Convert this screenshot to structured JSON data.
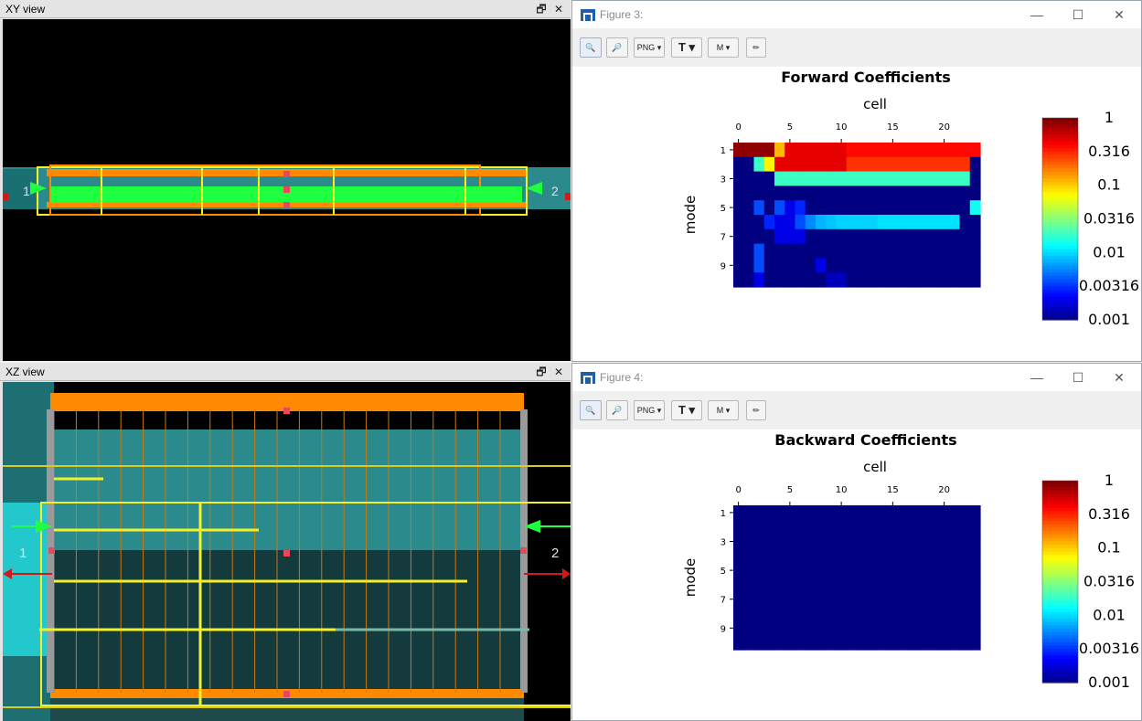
{
  "xy_view": {
    "title": "XY view",
    "restore_icon": "🗗",
    "close_icon": "✕",
    "port1": "1",
    "port2": "2"
  },
  "xz_view": {
    "title": "XZ view",
    "restore_icon": "🗗",
    "close_icon": "✕",
    "port1": "1",
    "port2": "2"
  },
  "figures": [
    {
      "window_title": "Figure 3:",
      "toolbar": {
        "png_label": "PNG",
        "text_label": "T",
        "marker_label": "M"
      },
      "chart_data": {
        "type": "heatmap",
        "title": "Forward Coefficients",
        "xlabel": "cell",
        "ylabel": "mode",
        "xticks": [
          "0",
          "5",
          "10",
          "15",
          "20"
        ],
        "yticks": [
          "1",
          "3",
          "5",
          "7",
          "9"
        ],
        "colorbar_ticks": [
          "1",
          "0.316",
          "0.1",
          "0.0316",
          "0.01",
          "0.00316",
          "0.001"
        ],
        "colorbar_range": [
          0.001,
          1
        ],
        "scale": "log",
        "colormap": "jet",
        "columns": 24,
        "rows": 10,
        "values": [
          [
            0.9,
            0.9,
            0.9,
            0.9,
            0.12,
            0.5,
            0.5,
            0.5,
            0.5,
            0.5,
            0.5,
            0.4,
            0.4,
            0.4,
            0.4,
            0.4,
            0.4,
            0.4,
            0.4,
            0.4,
            0.4,
            0.4,
            0.4,
            0.4
          ],
          [
            0.001,
            0.001,
            0.02,
            0.08,
            0.5,
            0.5,
            0.5,
            0.5,
            0.5,
            0.5,
            0.5,
            0.3,
            0.3,
            0.3,
            0.3,
            0.3,
            0.3,
            0.3,
            0.3,
            0.3,
            0.3,
            0.3,
            0.3,
            0.001
          ],
          [
            0.001,
            0.001,
            0.001,
            0.001,
            0.02,
            0.02,
            0.02,
            0.02,
            0.02,
            0.02,
            0.02,
            0.02,
            0.02,
            0.02,
            0.02,
            0.02,
            0.02,
            0.02,
            0.02,
            0.02,
            0.02,
            0.02,
            0.02,
            0.001
          ],
          [
            0.001,
            0.001,
            0.001,
            0.001,
            0.001,
            0.001,
            0.001,
            0.001,
            0.001,
            0.001,
            0.001,
            0.001,
            0.001,
            0.001,
            0.001,
            0.001,
            0.001,
            0.001,
            0.001,
            0.001,
            0.001,
            0.001,
            0.001,
            0.001
          ],
          [
            0.001,
            0.001,
            0.004,
            0.001,
            0.004,
            0.002,
            0.003,
            0.001,
            0.001,
            0.001,
            0.001,
            0.001,
            0.001,
            0.001,
            0.001,
            0.001,
            0.001,
            0.001,
            0.001,
            0.001,
            0.001,
            0.001,
            0.001,
            0.015
          ],
          [
            0.001,
            0.001,
            0.001,
            0.003,
            0.002,
            0.002,
            0.004,
            0.006,
            0.008,
            0.009,
            0.01,
            0.01,
            0.01,
            0.01,
            0.011,
            0.011,
            0.011,
            0.011,
            0.011,
            0.011,
            0.011,
            0.011,
            0.001,
            0.001
          ],
          [
            0.001,
            0.001,
            0.001,
            0.001,
            0.002,
            0.002,
            0.002,
            0.001,
            0.001,
            0.001,
            0.001,
            0.001,
            0.001,
            0.001,
            0.001,
            0.001,
            0.001,
            0.001,
            0.001,
            0.001,
            0.001,
            0.001,
            0.001,
            0.001
          ],
          [
            0.001,
            0.001,
            0.004,
            0.001,
            0.001,
            0.001,
            0.001,
            0.001,
            0.001,
            0.001,
            0.001,
            0.001,
            0.001,
            0.001,
            0.001,
            0.001,
            0.001,
            0.001,
            0.001,
            0.001,
            0.001,
            0.001,
            0.001,
            0.001
          ],
          [
            0.001,
            0.001,
            0.004,
            0.001,
            0.001,
            0.001,
            0.001,
            0.001,
            0.002,
            0.001,
            0.001,
            0.001,
            0.001,
            0.001,
            0.001,
            0.001,
            0.001,
            0.001,
            0.001,
            0.001,
            0.001,
            0.001,
            0.001,
            0.001
          ],
          [
            0.001,
            0.001,
            0.002,
            0.001,
            0.001,
            0.001,
            0.001,
            0.001,
            0.001,
            0.0015,
            0.0015,
            0.001,
            0.001,
            0.001,
            0.001,
            0.001,
            0.001,
            0.001,
            0.001,
            0.001,
            0.001,
            0.001,
            0.001,
            0.001
          ]
        ]
      }
    },
    {
      "window_title": "Figure 4:",
      "toolbar": {
        "png_label": "PNG",
        "text_label": "T",
        "marker_label": "M"
      },
      "chart_data": {
        "type": "heatmap",
        "title": "Backward Coefficients",
        "xlabel": "cell",
        "ylabel": "mode",
        "xticks": [
          "0",
          "5",
          "10",
          "15",
          "20"
        ],
        "yticks": [
          "1",
          "3",
          "5",
          "7",
          "9"
        ],
        "colorbar_ticks": [
          "1",
          "0.316",
          "0.1",
          "0.0316",
          "0.01",
          "0.00316",
          "0.001"
        ],
        "colorbar_range": [
          0.001,
          1
        ],
        "scale": "log",
        "colormap": "jet",
        "columns": 24,
        "rows": 10,
        "uniform_value": 0.001
      }
    }
  ],
  "colors": {
    "viewport_bg": "#000000",
    "waveguide_teal": "#2b8a8c",
    "waveguide_dark": "#133a3c",
    "port_cyan": "#22c8cc",
    "structure_orange": "#ff8a00",
    "mesh_line": "#c87a10",
    "highlight_yellow": "#f6f02a",
    "monitor_green": "#1dff3f",
    "port_red": "#d41818",
    "heatmap_low": "#00008f"
  }
}
